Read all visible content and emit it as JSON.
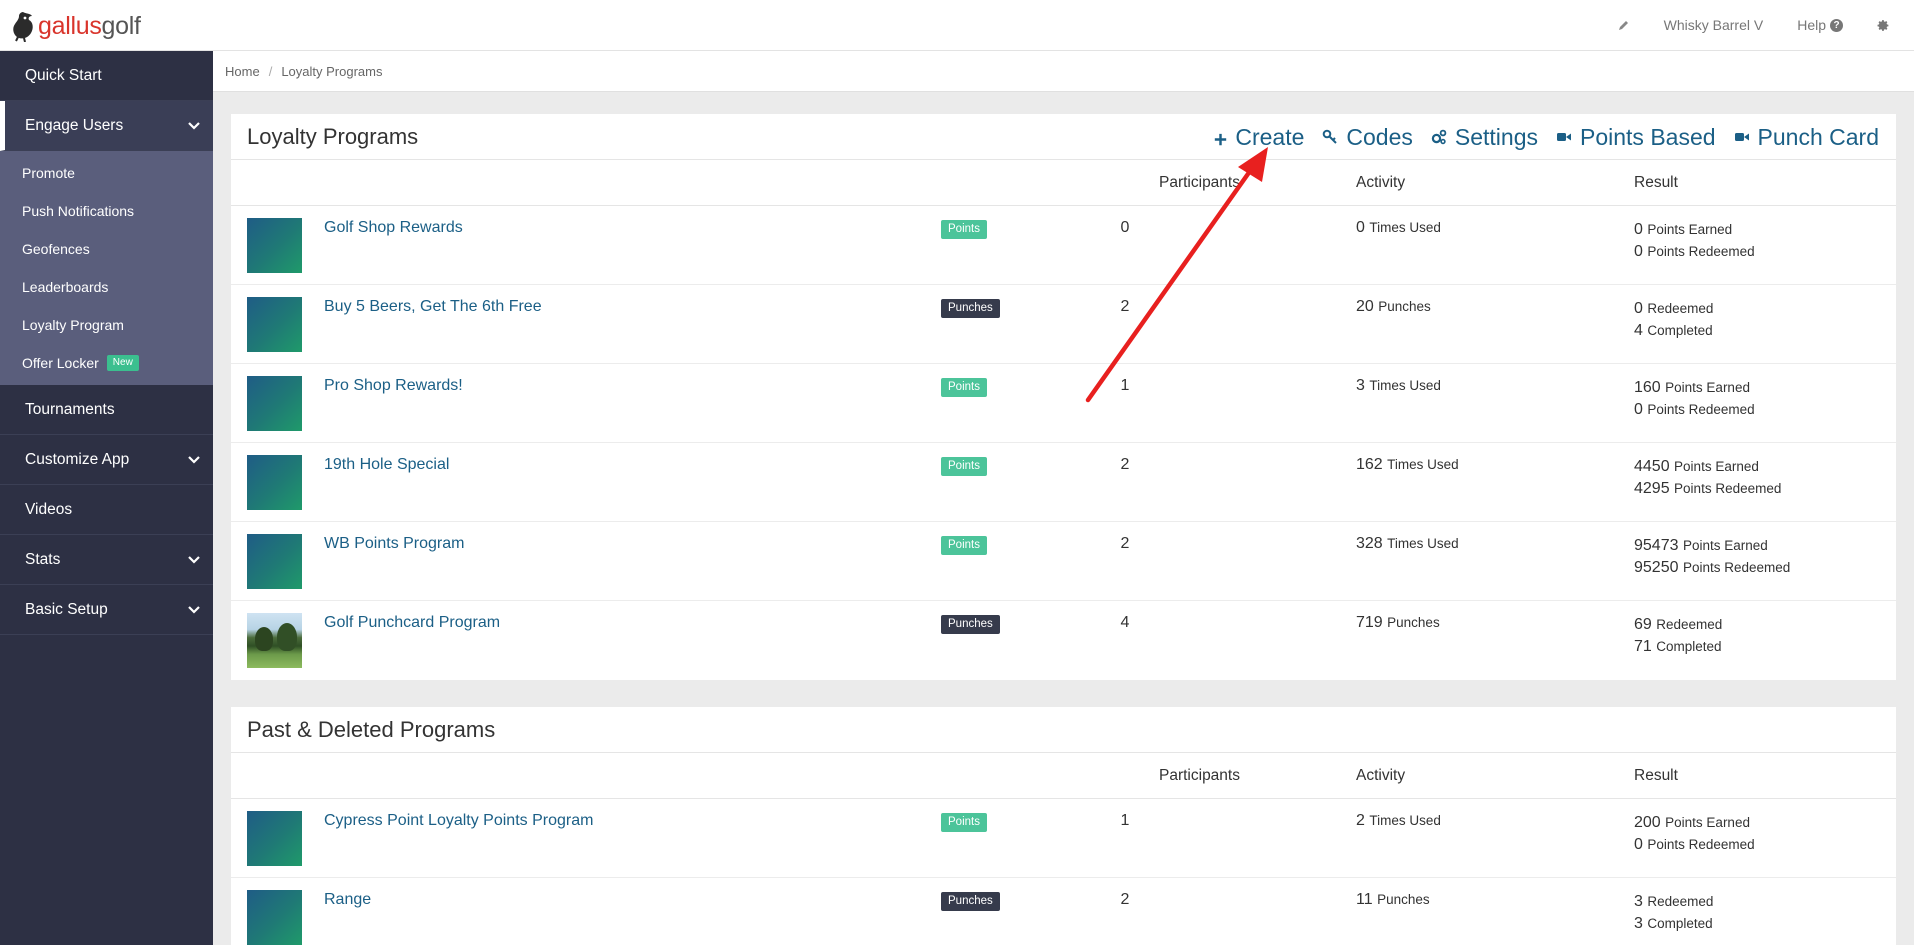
{
  "brand": {
    "part1": "gallus",
    "part2": "golf",
    "accent": "#d9342b"
  },
  "topbar": {
    "pencil_icon": "pencil-icon",
    "account_name": "Whisky Barrel V",
    "help_label": "Help",
    "help_glyph": "?",
    "gear_icon": "gear-icon"
  },
  "sidebar": {
    "items": [
      {
        "label": "Quick Start"
      },
      {
        "label": "Engage Users",
        "expanded": true
      },
      {
        "label": "Tournaments"
      },
      {
        "label": "Customize App"
      },
      {
        "label": "Videos"
      },
      {
        "label": "Stats"
      },
      {
        "label": "Basic Setup"
      }
    ],
    "sub_items": [
      {
        "label": "Promote"
      },
      {
        "label": "Push Notifications"
      },
      {
        "label": "Geofences"
      },
      {
        "label": "Leaderboards"
      },
      {
        "label": "Loyalty Program"
      },
      {
        "label": "Offer Locker",
        "badge": "New"
      }
    ]
  },
  "breadcrumb": {
    "home": "Home",
    "sep": "/",
    "current": "Loyalty Programs"
  },
  "loyalty": {
    "title": "Loyalty Programs",
    "actions": [
      {
        "label": "Create",
        "icon": "plus-icon"
      },
      {
        "label": "Codes",
        "icon": "key-icon"
      },
      {
        "label": "Settings",
        "icon": "cogs-icon"
      },
      {
        "label": "Points Based",
        "icon": "video-camera-icon"
      },
      {
        "label": "Punch Card",
        "icon": "video-camera-icon"
      }
    ],
    "columns": {
      "participants": "Participants",
      "activity": "Activity",
      "result": "Result"
    },
    "rows": [
      {
        "name": "Golf Shop Rewards",
        "tag": "Points",
        "participants": "0",
        "activity_n": "0",
        "activity_u": "Times Used",
        "r1n": "0",
        "r1u": "Points Earned",
        "r2n": "0",
        "r2u": "Points Redeemed"
      },
      {
        "name": "Buy 5 Beers, Get The 6th Free",
        "tag": "Punches",
        "participants": "2",
        "activity_n": "20",
        "activity_u": "Punches",
        "r1n": "0",
        "r1u": "Redeemed",
        "r2n": "4",
        "r2u": "Completed"
      },
      {
        "name": "Pro Shop Rewards!",
        "tag": "Points",
        "participants": "1",
        "activity_n": "3",
        "activity_u": "Times Used",
        "r1n": "160",
        "r1u": "Points Earned",
        "r2n": "0",
        "r2u": "Points Redeemed"
      },
      {
        "name": "19th Hole Special",
        "tag": "Points",
        "participants": "2",
        "activity_n": "162",
        "activity_u": "Times Used",
        "r1n": "4450",
        "r1u": "Points Earned",
        "r2n": "4295",
        "r2u": "Points Redeemed"
      },
      {
        "name": "WB Points Program",
        "tag": "Points",
        "participants": "2",
        "activity_n": "328",
        "activity_u": "Times Used",
        "r1n": "95473",
        "r1u": "Points Earned",
        "r2n": "95250",
        "r2u": "Points Redeemed"
      },
      {
        "name": "Golf Punchcard Program",
        "tag": "Punches",
        "participants": "4",
        "activity_n": "719",
        "activity_u": "Punches",
        "r1n": "69",
        "r1u": "Redeemed",
        "r2n": "71",
        "r2u": "Completed"
      }
    ]
  },
  "past": {
    "title": "Past & Deleted Programs",
    "columns": {
      "participants": "Participants",
      "activity": "Activity",
      "result": "Result"
    },
    "rows": [
      {
        "name": "Cypress Point Loyalty Points Program",
        "tag": "Points",
        "participants": "1",
        "activity_n": "2",
        "activity_u": "Times Used",
        "r1n": "200",
        "r1u": "Points Earned",
        "r2n": "0",
        "r2u": "Points Redeemed"
      },
      {
        "name": "Range",
        "tag": "Punches",
        "participants": "2",
        "activity_n": "11",
        "activity_u": "Punches",
        "r1n": "3",
        "r1u": "Redeemed",
        "r2n": "3",
        "r2u": "Completed"
      }
    ]
  },
  "colors": {
    "link": "#1b5f86",
    "sidebar": "#2d3044",
    "submenu": "#5a5e7c",
    "points_tag": "#4cc49a",
    "punches_tag": "#363b4c",
    "annotation_arrow": "#e8201f"
  }
}
